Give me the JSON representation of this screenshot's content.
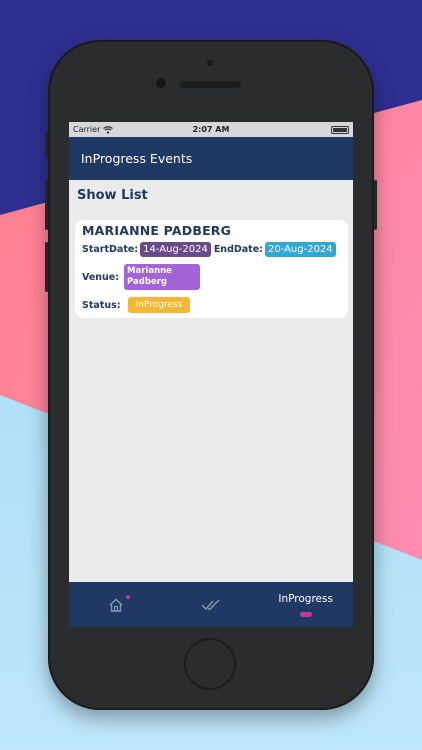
{
  "status_bar": {
    "carrier": "Carrier",
    "time": "2:07 AM"
  },
  "nav": {
    "title": "InProgress Events"
  },
  "section": {
    "title": "Show List"
  },
  "event": {
    "name": "MARIANNE PADBERG",
    "start_label": "StartDate:",
    "start_value": "14-Aug-2024",
    "end_label": "EndDate:",
    "end_value": "20-Aug-2024",
    "venue_label": "Venue:",
    "venue_value": "Marianne Padberg",
    "status_label": "Status:",
    "status_value": "InProgress"
  },
  "tabs": {
    "active_label": "InProgress",
    "icons": [
      "home-icon",
      "double-check-icon"
    ]
  },
  "colors": {
    "nav_bg": "#1f3864",
    "start_chip": "#6b4a8a",
    "end_chip": "#2fa8d8",
    "venue_chip": "#a463d6",
    "status_chip": "#f7b733",
    "accent": "#c73a91"
  }
}
